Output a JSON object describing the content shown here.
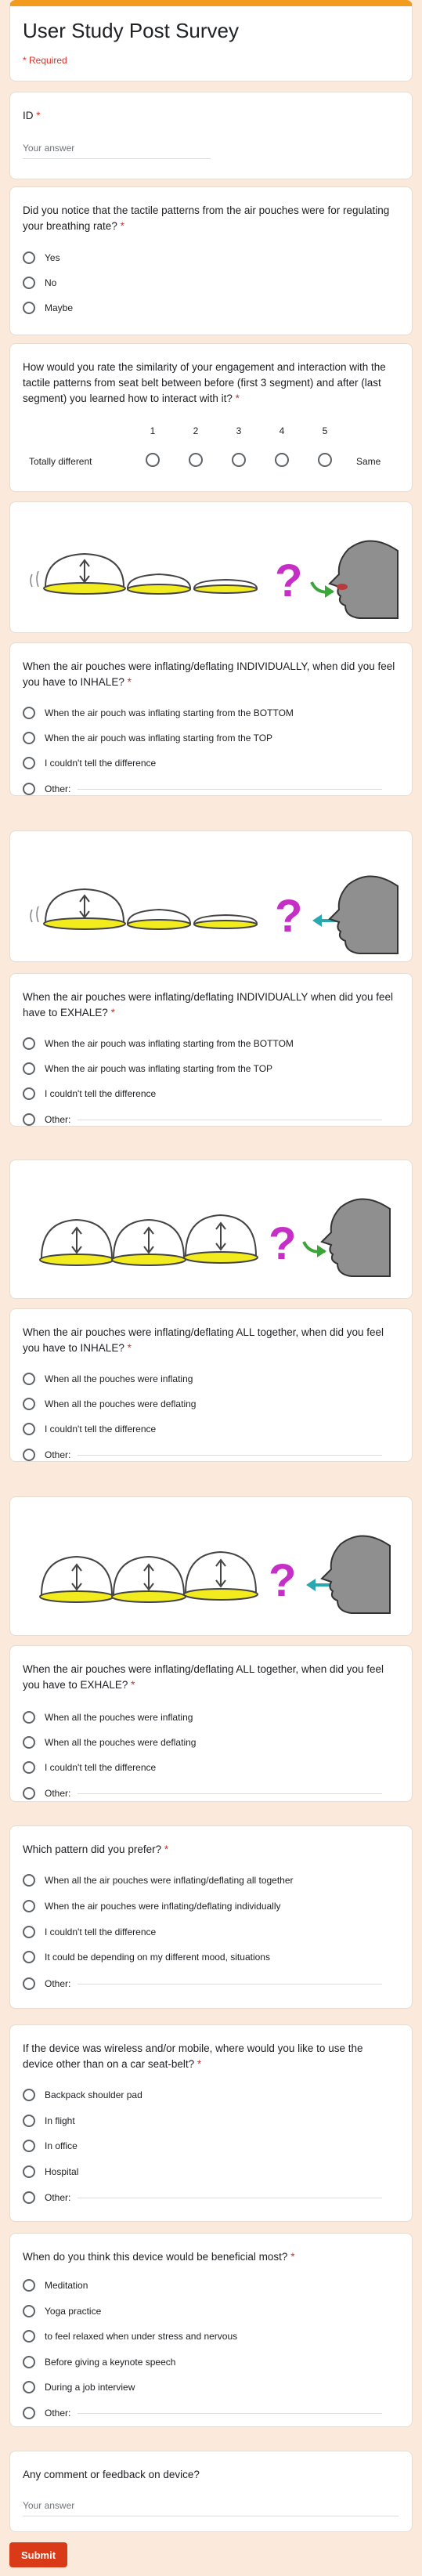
{
  "form": {
    "title": "User Study Post Survey",
    "required_note": "* Required",
    "submit_label": "Submit"
  },
  "q_id": {
    "title": "ID",
    "required": "*",
    "placeholder": "Your answer"
  },
  "q_notice": {
    "title": "Did you notice that the tactile patterns from the air pouches were for regulating your breathing rate?",
    "required": "*",
    "options": [
      "Yes",
      "No",
      "Maybe"
    ]
  },
  "q_similarity": {
    "title": "How would you rate the similarity of your engagement and interaction with the tactile patterns from seat belt between before (first 3 segment) and after (last segment) you learned how to interact with it?",
    "required": "*",
    "scale": [
      "1",
      "2",
      "3",
      "4",
      "5"
    ],
    "low_label": "Totally different",
    "high_label": "Same"
  },
  "q_ind_inhale": {
    "title": "When the air pouches were inflating/deflating INDIVIDUALLY, when did you feel you have to INHALE?",
    "required": "*",
    "options": [
      "When the air pouch was inflating starting from the BOTTOM",
      "When the air pouch was inflating starting from the TOP",
      "I couldn't tell the difference",
      "Other:"
    ]
  },
  "q_ind_exhale": {
    "title": "When the air pouches were inflating/deflating INDIVIDUALLY when did you feel have to EXHALE?",
    "required": "*",
    "options": [
      "When the air pouch was inflating starting from the BOTTOM",
      "When the air pouch was inflating starting from the TOP",
      "I couldn't tell the difference",
      "Other:"
    ]
  },
  "q_all_inhale": {
    "title": "When the air pouches were inflating/deflating ALL together, when did you feel you have to INHALE?",
    "required": "*",
    "options": [
      "When all the pouches were inflating",
      "When all the pouches were deflating",
      "I couldn't tell the difference",
      "Other:"
    ]
  },
  "q_all_exhale": {
    "title": "When the air pouches were inflating/deflating ALL together, when did you feel you have to EXHALE?",
    "required": "*",
    "options": [
      "When all the pouches were inflating",
      "When all the pouches were deflating",
      "I couldn't tell the difference",
      "Other:"
    ]
  },
  "q_prefer": {
    "title": "Which pattern did you prefer?",
    "required": "*",
    "options": [
      "When all the air pouches were inflating/deflating all together",
      "When the air pouches were inflating/deflating individually",
      "I couldn't tell the difference",
      "It could be depending on my different mood, situations",
      "Other:"
    ]
  },
  "q_where": {
    "title": "If the device was wireless and/or mobile, where would you like to use the device other than on a car seat-belt?",
    "required": "*",
    "options": [
      "Backpack shoulder pad",
      "In flight",
      "In office",
      "Hospital",
      "Other:"
    ]
  },
  "q_beneficial": {
    "title": "When do you think this device would be beneficial most?",
    "required": "*",
    "options": [
      "Meditation",
      "Yoga practice",
      "to feel relaxed when under stress and nervous",
      "Before giving a keynote speech",
      "During a job interview",
      "Other:"
    ]
  },
  "q_comment": {
    "title": "Any comment or feedback on device?",
    "placeholder": "Your answer"
  },
  "colors": {
    "accent": "#f29b1c",
    "submit": "#d93a17",
    "required": "#d93025",
    "pouch_yellow": "#f2ec1f",
    "question_mark": "#c62fc6",
    "arrow_green": "#3aa63a",
    "arrow_teal": "#2aa8b0",
    "head_gray": "#8f8f8f"
  },
  "icons": {
    "question_mark": "question-mark-icon",
    "face": "face-profile-icon",
    "arrow": "breath-arrow-icon",
    "pouch": "air-pouch-icon"
  }
}
